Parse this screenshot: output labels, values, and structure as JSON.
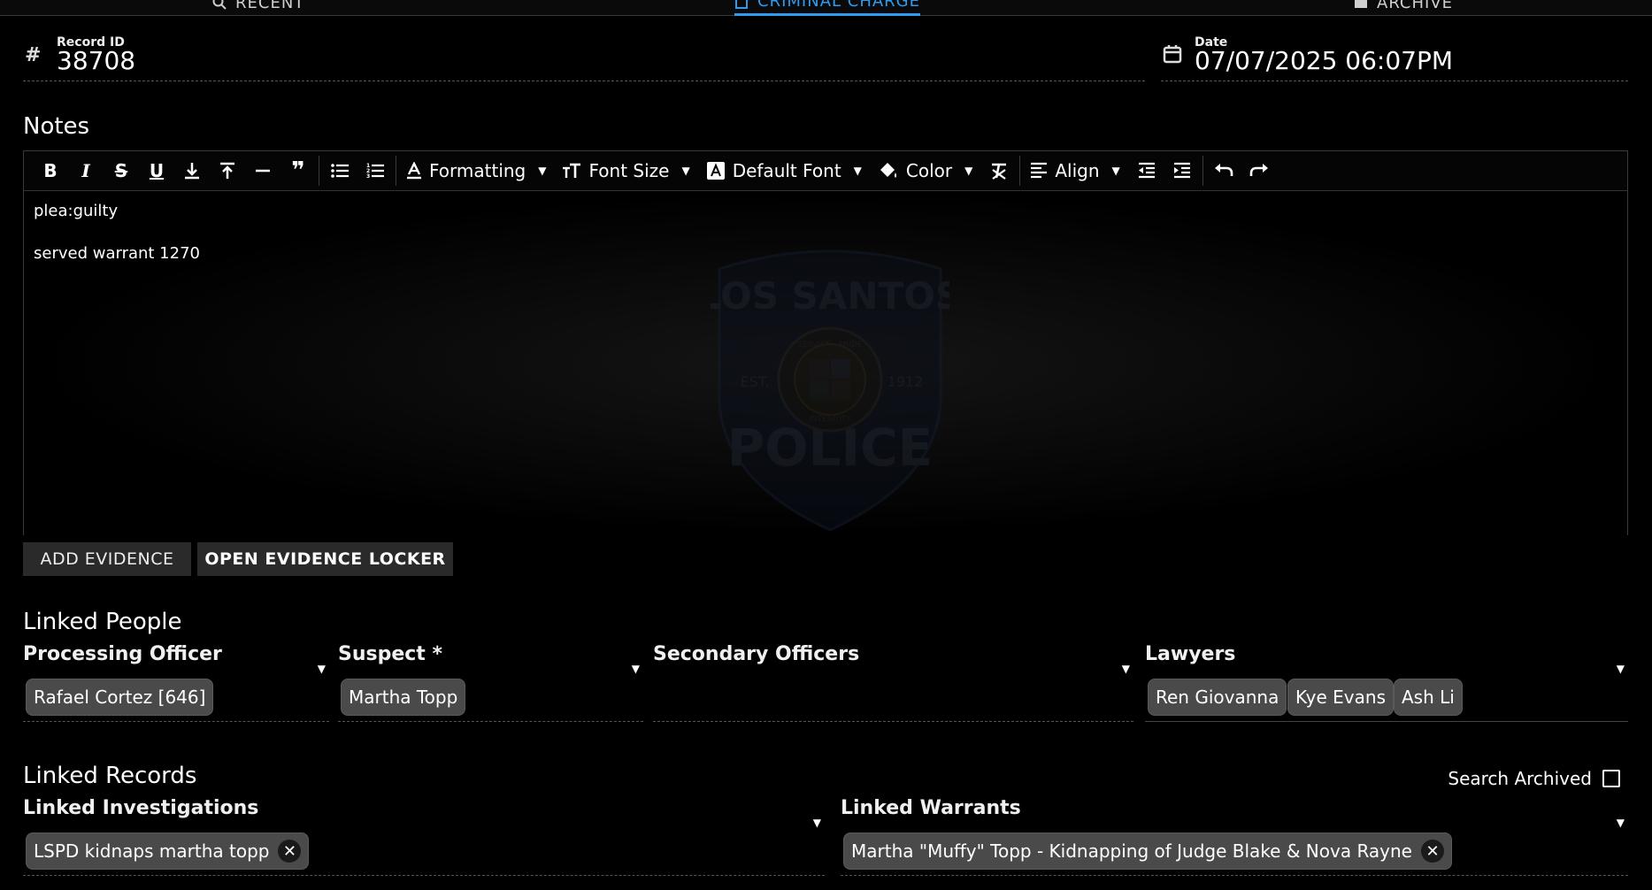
{
  "tabs": [
    {
      "label": "RECENT",
      "icon": "search-icon",
      "active": false
    },
    {
      "label": "CRIMINAL CHARGE",
      "icon": "document-icon",
      "active": true
    },
    {
      "label": "ARCHIVE",
      "icon": "archive-icon",
      "active": false
    }
  ],
  "header": {
    "record_id_label": "Record ID",
    "record_id_value": "38708",
    "date_label": "Date",
    "date_value": "07/07/2025 06:07PM"
  },
  "notes": {
    "title": "Notes",
    "toolbar": {
      "formatting": "Formatting",
      "font_size": "Font Size",
      "default_font": "Default Font",
      "color": "Color",
      "align": "Align"
    },
    "lines": [
      "plea:guilty",
      "served warrant 1270"
    ],
    "watermark": {
      "top": "LOS SANTOS",
      "bottom": "POLICE",
      "est_left": "EST.",
      "est_right": "1912",
      "ring_top": "SERVICE · PRIDE",
      "ring_bottom": "INTEGRITY"
    }
  },
  "evidence": {
    "add_label": "ADD EVIDENCE",
    "open_label": "OPEN EVIDENCE LOCKER"
  },
  "linked_people": {
    "title": "Linked People",
    "processing_officer": {
      "label": "Processing Officer",
      "chips": [
        "Rafael Cortez [646]"
      ]
    },
    "suspect": {
      "label": "Suspect *",
      "chips": [
        "Martha Topp"
      ]
    },
    "secondary_officers": {
      "label": "Secondary Officers",
      "chips": []
    },
    "lawyers": {
      "label": "Lawyers",
      "chips": [
        "Ren Giovanna",
        "Kye Evans",
        "Ash Li"
      ]
    }
  },
  "linked_records": {
    "title": "Linked Records",
    "search_archived_label": "Search Archived",
    "search_archived_checked": false,
    "investigations": {
      "label": "Linked Investigations",
      "chips": [
        "LSPD kidnaps martha topp"
      ]
    },
    "warrants": {
      "label": "Linked Warrants",
      "chips": [
        "Martha \"Muffy\" Topp - Kidnapping of Judge Blake & Nova Rayne"
      ]
    }
  },
  "colors": {
    "accent": "#2e9cf0",
    "chip_bg": "#4a4a4a",
    "button_bg": "#2a2a2a"
  }
}
